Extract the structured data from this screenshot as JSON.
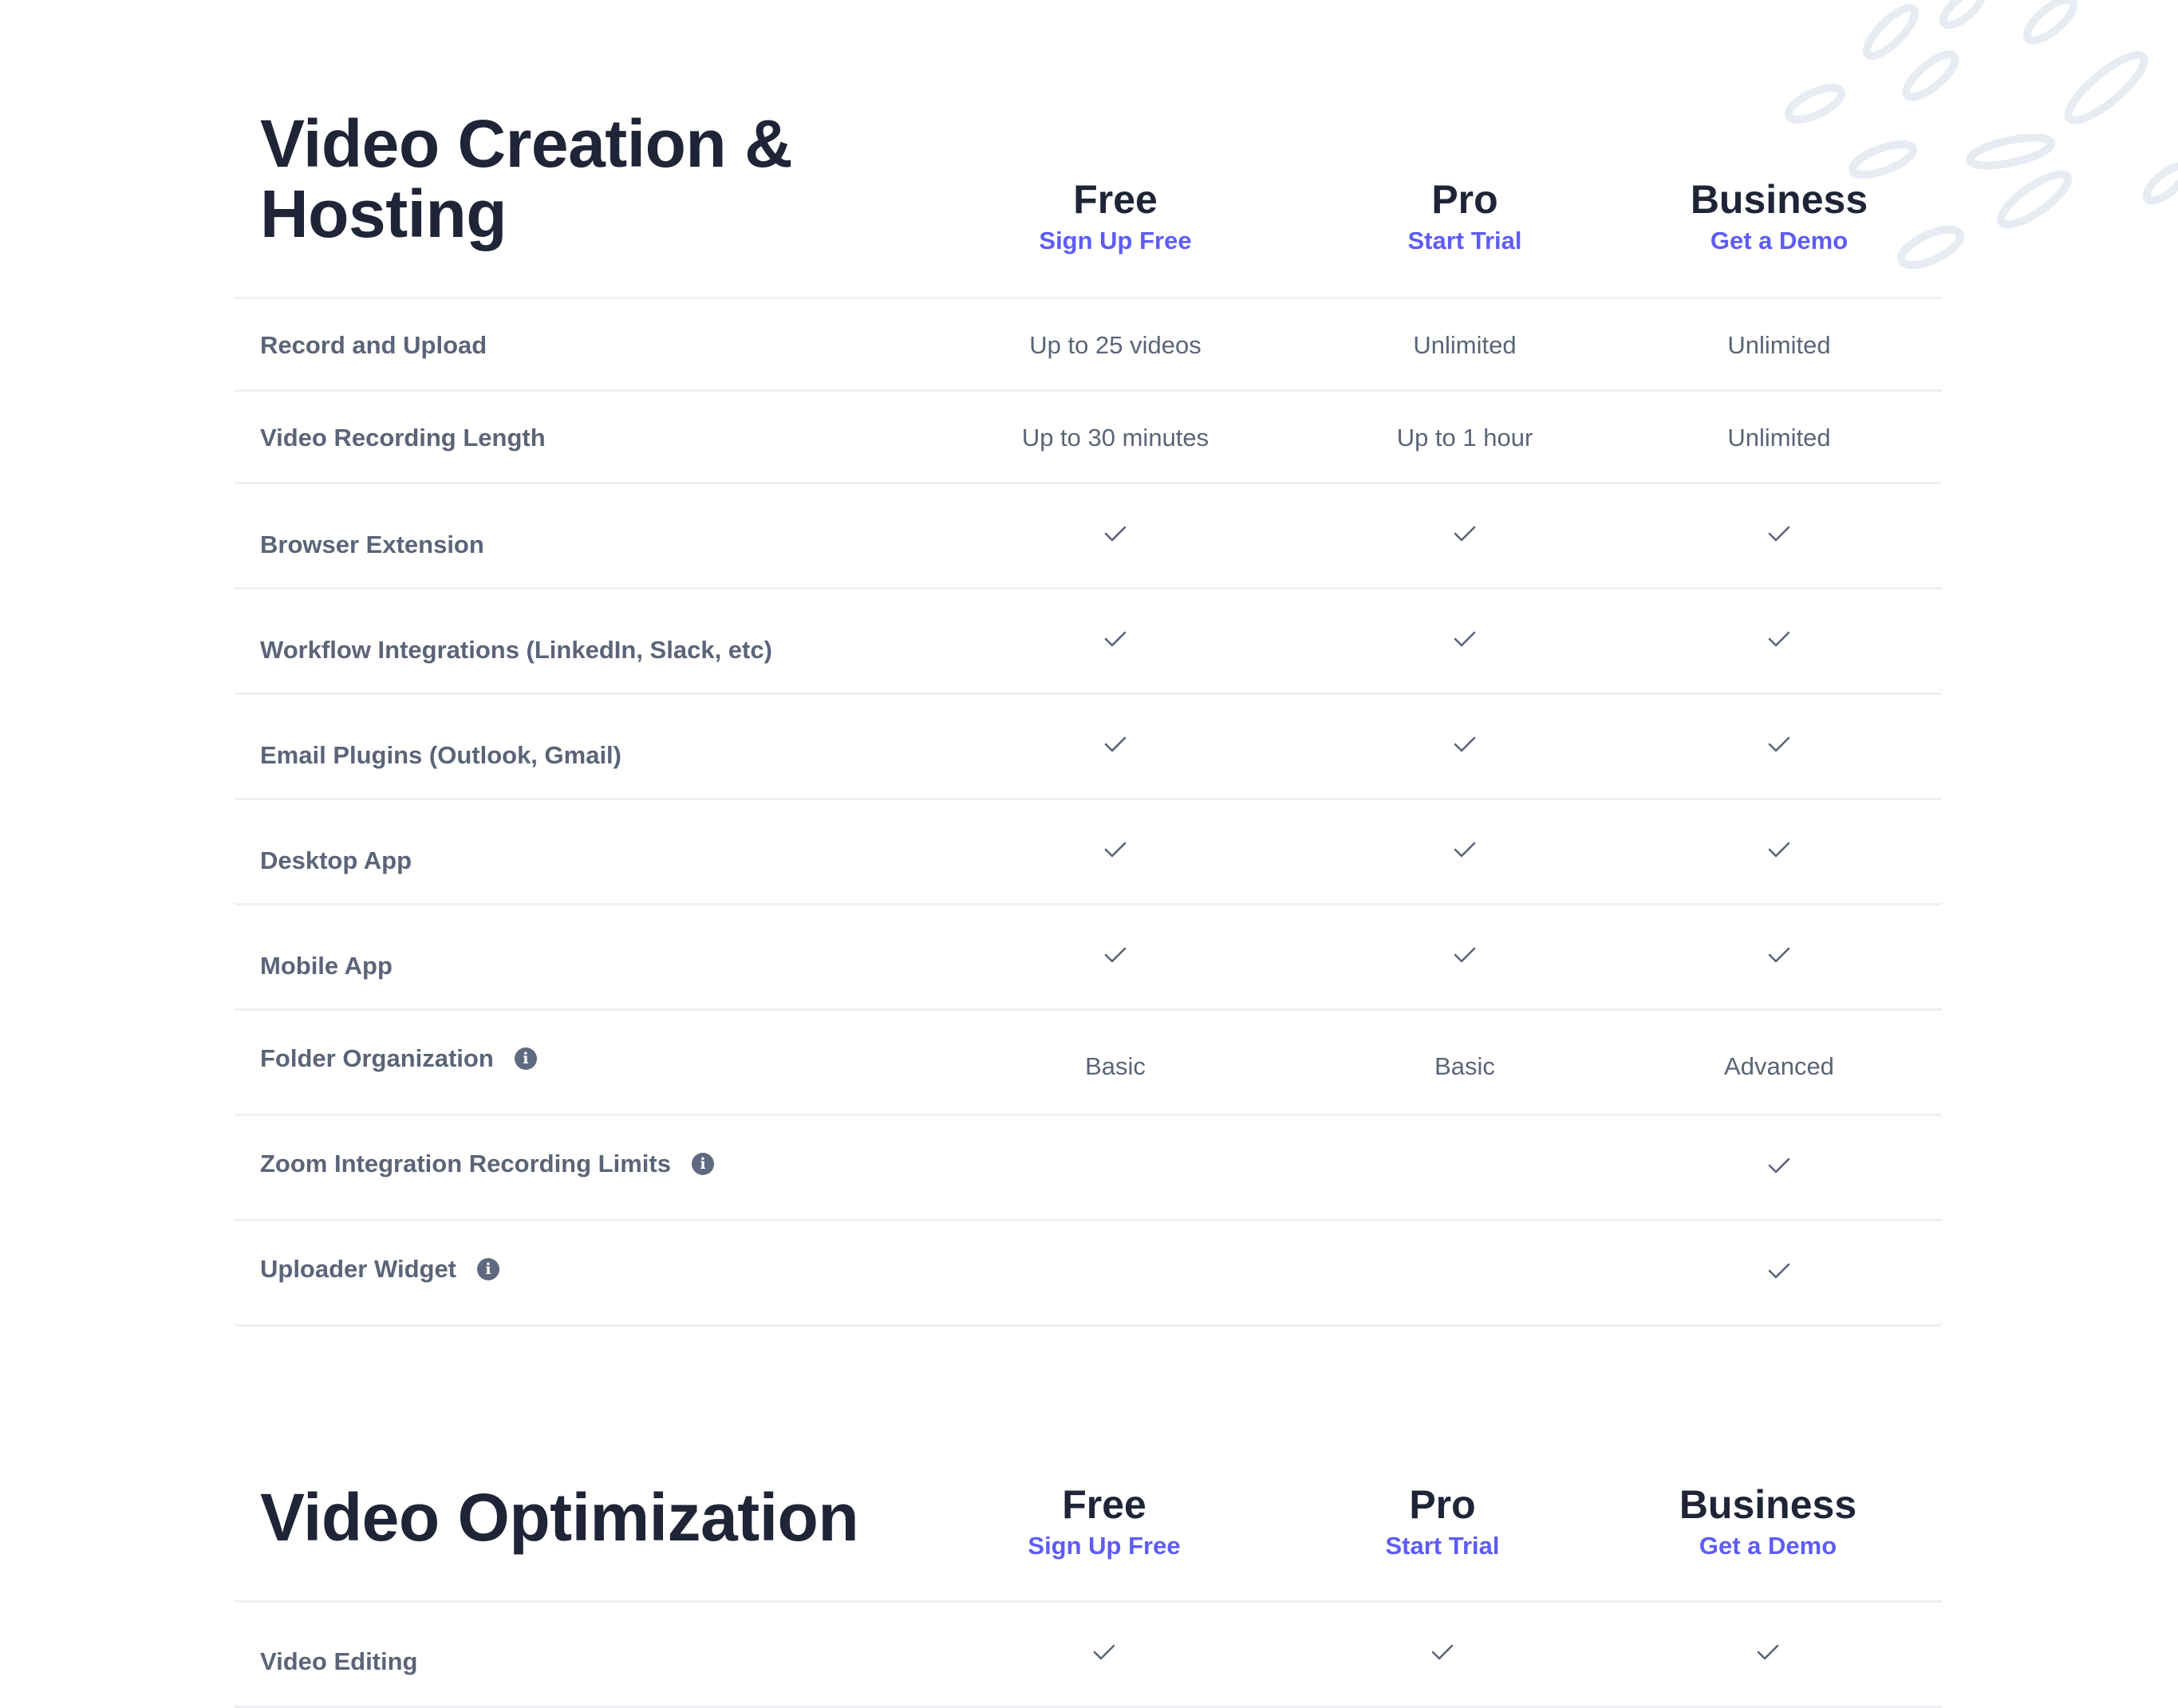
{
  "section1": {
    "title": "Video Creation & Hosting",
    "plans": [
      {
        "name": "Free",
        "cta": "Sign Up Free"
      },
      {
        "name": "Pro",
        "cta": "Start Trial"
      },
      {
        "name": "Business",
        "cta": "Get a Demo"
      }
    ],
    "rows": [
      {
        "feature": "Record and Upload",
        "info": false,
        "free": "Up to 25 videos",
        "pro": "Unlimited",
        "business": "Unlimited"
      },
      {
        "feature": "Video Recording Length",
        "info": false,
        "free": "Up to 30 minutes",
        "pro": "Up to 1 hour",
        "business": "Unlimited"
      },
      {
        "feature": "Browser Extension",
        "info": false,
        "free": "check",
        "pro": "check",
        "business": "check"
      },
      {
        "feature": "Workflow Integrations (LinkedIn, Slack, etc)",
        "info": false,
        "free": "check",
        "pro": "check",
        "business": "check"
      },
      {
        "feature": "Email Plugins (Outlook, Gmail)",
        "info": false,
        "free": "check",
        "pro": "check",
        "business": "check"
      },
      {
        "feature": "Desktop App",
        "info": false,
        "free": "check",
        "pro": "check",
        "business": "check"
      },
      {
        "feature": "Mobile App",
        "info": false,
        "free": "check",
        "pro": "check",
        "business": "check"
      },
      {
        "feature": "Folder Organization",
        "info": true,
        "free": "Basic",
        "pro": "Basic",
        "business": "Advanced"
      },
      {
        "feature": "Zoom Integration Recording Limits",
        "info": true,
        "free": "",
        "pro": "",
        "business": "check"
      },
      {
        "feature": "Uploader Widget",
        "info": true,
        "free": "",
        "pro": "",
        "business": "check"
      }
    ]
  },
  "section2": {
    "title": "Video Optimization",
    "plans": [
      {
        "name": "Free",
        "cta": "Sign Up Free"
      },
      {
        "name": "Pro",
        "cta": "Start Trial"
      },
      {
        "name": "Business",
        "cta": "Get a Demo"
      }
    ],
    "rows": [
      {
        "feature": "Video Editing",
        "info": false,
        "free": "check",
        "pro": "check",
        "business": "check"
      }
    ]
  },
  "icons": {
    "check": "check-icon",
    "info": "info-icon",
    "info_glyph": "i"
  },
  "colors": {
    "accent": "#5d5cf5",
    "heading": "#1f2537",
    "body": "#5b6478",
    "divider": "#eef0f4",
    "decor": "#e7ecf3"
  }
}
